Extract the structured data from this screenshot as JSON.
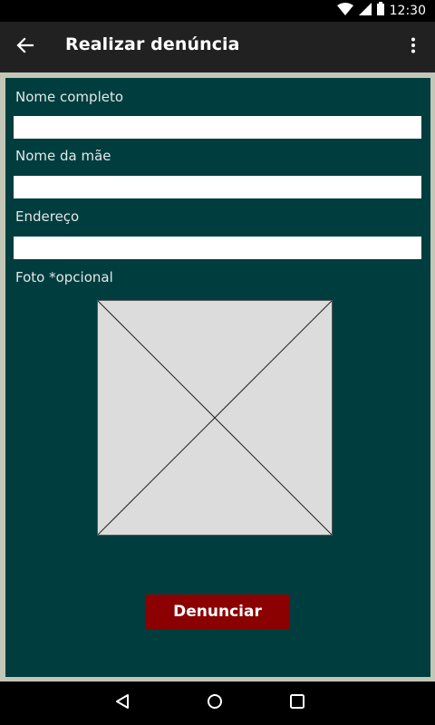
{
  "status_bar": {
    "time": "12:30",
    "icons": [
      "wifi-icon",
      "signal-icon",
      "battery-icon"
    ]
  },
  "app_bar": {
    "title": "Realizar denúncia",
    "back_icon": "arrow-back-icon",
    "menu_icon": "more-vert-icon"
  },
  "form": {
    "full_name": {
      "label": "Nome completo",
      "value": ""
    },
    "mother_name": {
      "label": "Nome da mãe",
      "value": ""
    },
    "address": {
      "label": "Endereço",
      "value": ""
    },
    "photo": {
      "label": "Foto *opcional",
      "icon": "image-placeholder-icon"
    },
    "submit_label": "Denunciar"
  },
  "nav_bar": {
    "icons": [
      "back-triangle-icon",
      "home-circle-icon",
      "recents-square-icon"
    ]
  },
  "colors": {
    "status_bar": "#000000",
    "app_bar": "#212121",
    "frame": "#c3c7b8",
    "content_bg": "#003d3f",
    "submit_bg": "#8b0000",
    "input_bg": "#ffffff",
    "placeholder_bg": "#dcdcdc"
  }
}
